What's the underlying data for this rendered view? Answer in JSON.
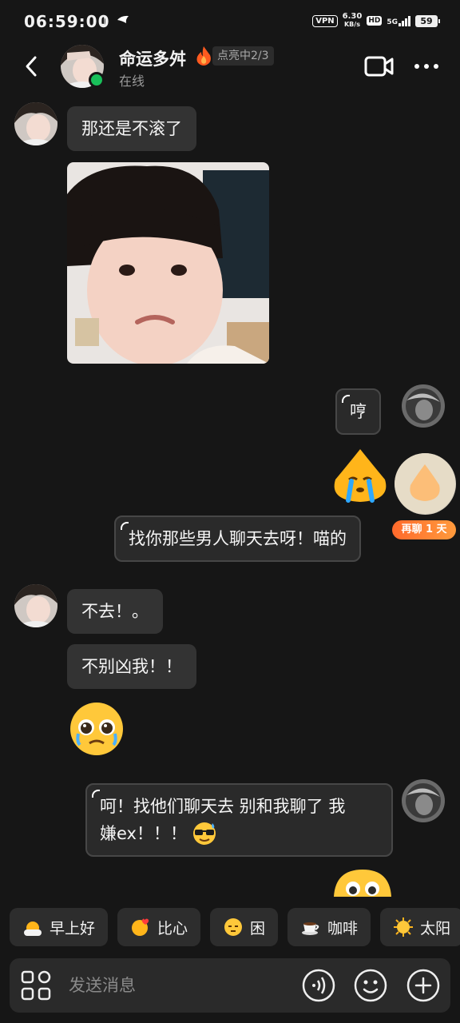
{
  "status_bar": {
    "time": "06:59:00",
    "vpn": "VPN",
    "net_speed_value": "6.30",
    "net_speed_unit": "KB/s",
    "hd": "HD",
    "network": "5G",
    "battery": "59"
  },
  "header": {
    "contact_name": "命运多舛",
    "streak_badge": "点亮中2/3",
    "status": "在线"
  },
  "messages": {
    "m1": "那还是不滚了",
    "m3": "哼",
    "m5": "找你那些男人聊天去呀！喵的",
    "m5_tag": "再聊 1 天",
    "m6": "不去！。",
    "m7": "不别凶我！！",
    "m9_line1": "呵！找他们聊天去 别和我聊了 我",
    "m9_line2": "嫌ex！！！"
  },
  "quick_replies": [
    {
      "label": "早上好",
      "icon": "sunrise-emoji-icon"
    },
    {
      "label": "比心",
      "icon": "finger-heart-emoji-icon"
    },
    {
      "label": "困",
      "icon": "sleepy-face-emoji-icon"
    },
    {
      "label": "咖啡",
      "icon": "coffee-cup-emoji-icon"
    },
    {
      "label": "太阳",
      "icon": "sun-emoji-icon"
    }
  ],
  "input": {
    "placeholder": "发送消息"
  },
  "colors": {
    "background": "#161616",
    "bubble_incoming": "#333333",
    "online_green": "#19c05a",
    "streak_orange": "#ff6a2c"
  }
}
